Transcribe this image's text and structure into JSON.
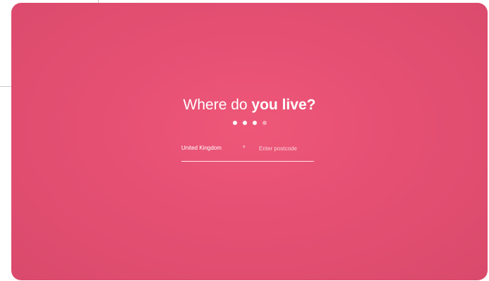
{
  "headline": {
    "prefix": "Where do",
    "emphasis": "you live?"
  },
  "progress": {
    "total_steps": 4,
    "completed_steps": 3
  },
  "form": {
    "country_value": "United Kingdom",
    "postcode_placeholder": "Enter postcode",
    "postcode_value": ""
  },
  "colors": {
    "panel_background": "#e65073",
    "panel_center": "#ee5778",
    "text": "#ffffff"
  },
  "icons": {
    "country_dropdown": "chevron-down-icon"
  }
}
